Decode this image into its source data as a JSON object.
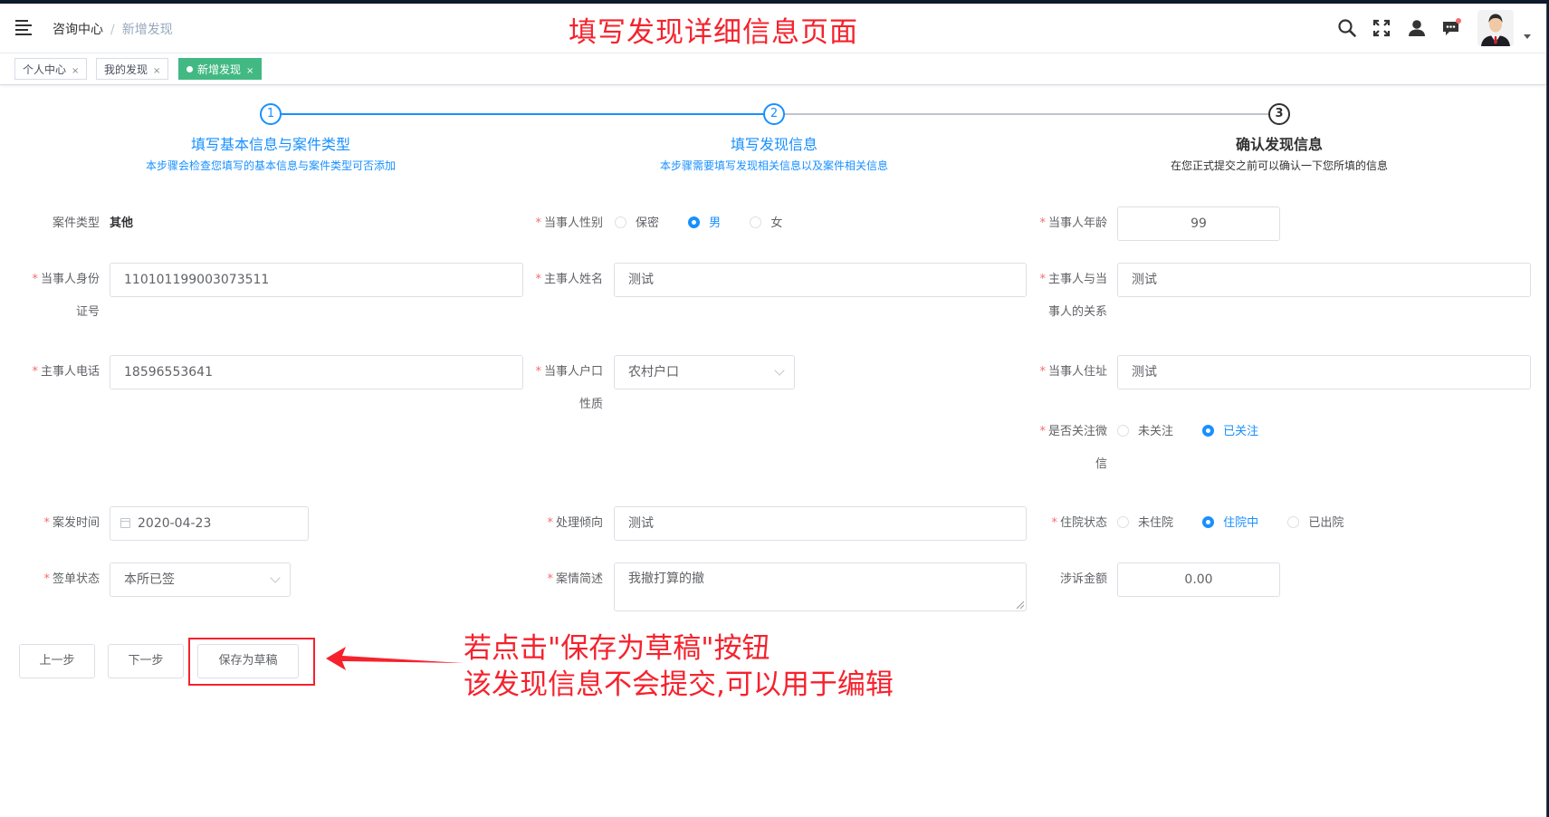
{
  "navbar": {
    "breadcrumb": [
      "咨询中心",
      "新增发现"
    ],
    "breadcrumb_sep": "/",
    "banner": "填写发现详细信息页面",
    "icons": [
      "search-icon",
      "fullscreen-icon",
      "user-icon",
      "message-icon"
    ]
  },
  "tags": [
    {
      "label": "个人中心",
      "close": "×"
    },
    {
      "label": "我的发现",
      "close": "×"
    },
    {
      "label": "新增发现",
      "close": "×",
      "active": true
    }
  ],
  "steps": [
    {
      "num": "1",
      "title": "填写基本信息与案件类型",
      "desc": "本步骤会检查您填写的基本信息与案件类型可否添加",
      "status": "finished"
    },
    {
      "num": "2",
      "title": "填写发现信息",
      "desc": "本步骤需要填写发现相关信息以及案件相关信息",
      "status": "current"
    },
    {
      "num": "3",
      "title": "确认发现信息",
      "desc": "在您正式提交之前可以确认一下您所填的信息",
      "status": "pending"
    }
  ],
  "form": {
    "case_type": {
      "label": "案件类型",
      "value": "其他"
    },
    "gender": {
      "label": "当事人性别",
      "options": [
        "保密",
        "男",
        "女"
      ],
      "selected": "男"
    },
    "age": {
      "label": "当事人年龄",
      "value": "99"
    },
    "id_card": {
      "label_1": "当事人身份",
      "label_2": "证号",
      "value": "110101199003073511"
    },
    "main_name": {
      "label": "主事人姓名",
      "value": "测试"
    },
    "relation": {
      "label_1": "主事人与当",
      "label_2": "事人的关系",
      "value": "测试"
    },
    "main_phone": {
      "label": "主事人电话",
      "value": "18596553641"
    },
    "household": {
      "label_1": "当事人户口",
      "label_2": "性质",
      "value": "农村户口"
    },
    "address": {
      "label": "当事人住址",
      "value": "测试"
    },
    "wechat": {
      "label_1": "是否关注微",
      "label_2": "信",
      "options": [
        "未关注",
        "已关注"
      ],
      "selected": "已关注"
    },
    "case_time": {
      "label": "案发时间",
      "value": "2020-04-23"
    },
    "handling": {
      "label": "处理倾向",
      "value": "测试"
    },
    "hospital": {
      "label": "住院状态",
      "options": [
        "未住院",
        "住院中",
        "已出院"
      ],
      "selected": "住院中"
    },
    "sign_status": {
      "label": "签单状态",
      "value": "本所已签"
    },
    "summary": {
      "label": "案情简述",
      "value": "我撤打算的撤"
    },
    "amount": {
      "label": "涉诉金额",
      "value": "0.00"
    }
  },
  "buttons": {
    "prev": "上一步",
    "next": "下一步",
    "draft": "保存为草稿"
  },
  "annotation": {
    "line1": "若点击\"保存为草稿\"按钮",
    "line2": "该发现信息不会提交,可以用于编辑"
  },
  "colors": {
    "primary": "#1890ff",
    "tag_active": "#42b983",
    "annotation": "#f5222d",
    "required": "#f56c6c"
  }
}
